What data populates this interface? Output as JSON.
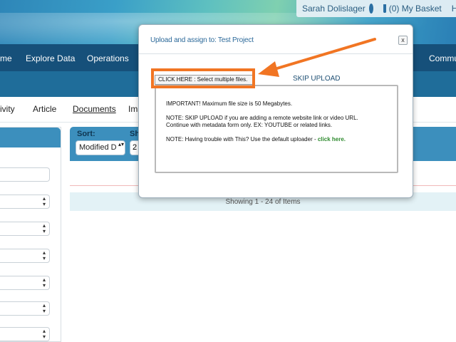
{
  "header": {
    "user_name": "Sarah Dolislager",
    "basket": "(0) My Basket",
    "help_partial": "He"
  },
  "nav": {
    "items": [
      "me",
      "Explore Data",
      "Operations",
      "Commu"
    ]
  },
  "tabs": {
    "items": [
      "ivity",
      "Article",
      "Documents",
      "Ima"
    ]
  },
  "results": {
    "sort_label": "Sort:",
    "sort_value": "Modified D",
    "show_label": "Sh",
    "show_value": "2",
    "showing_text": "Showing 1 - 24 of Items"
  },
  "modal": {
    "title": "Upload and assign to: Test Project",
    "close_label": "x",
    "select_files_label": "CLICK HERE : Select multiple files.",
    "skip_upload_label": "SKIP UPLOAD",
    "note_important": "IMPORTANT! Maximum file size is 50 Megabytes.",
    "note_skip_line1": "NOTE: SKIP UPLOAD if you are adding a remote website link or video URL.",
    "note_skip_line2": "Continue with metadata form only. EX: YOUTUBE or related links.",
    "note_trouble": "NOTE: Having trouble with This? Use the default uploader - ",
    "note_trouble_link": "click here."
  },
  "colors": {
    "nav_bg": "#16507a",
    "panel_header": "#3c8fbd",
    "annotation": "#f17523",
    "link_green": "#2e8a2e"
  },
  "icons": [
    "gear-icon",
    "cart-icon",
    "close-icon",
    "annotation-arrow"
  ]
}
